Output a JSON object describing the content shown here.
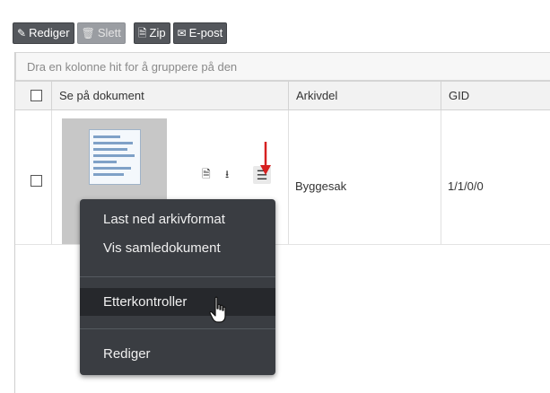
{
  "toolbar": {
    "edit_label": "Rediger",
    "delete_label": "Slett",
    "zip_label": "Zip",
    "email_label": "E-post"
  },
  "grid": {
    "group_hint": "Dra en kolonne hit for å gruppere på den",
    "columns": [
      "Se på dokument",
      "Arkivdel",
      "GID"
    ],
    "rows": [
      {
        "arkivdel": "Byggesak",
        "gid": "1/1/0/0"
      }
    ]
  },
  "context_menu": {
    "items": [
      "Last ned arkivformat",
      "Vis samledokument",
      "Etterkontroller",
      "Rediger"
    ],
    "active_item": "Etterkontroller"
  },
  "colors": {
    "toolbar_bg": "#54575c",
    "menu_bg": "#3a3d42",
    "annotation_arrow": "#d62020"
  },
  "icons": [
    "pencil-icon",
    "trash-icon",
    "zip-file-icon",
    "envelope-icon",
    "document-icon",
    "download-icon",
    "hamburger-menu-icon",
    "hand-pointer-cursor"
  ]
}
